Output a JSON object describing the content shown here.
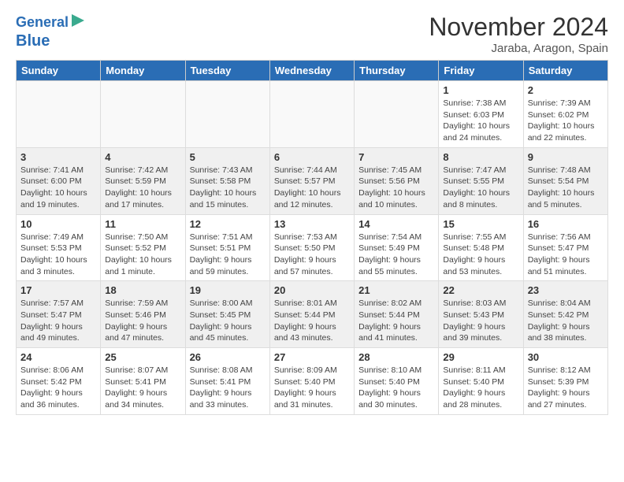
{
  "header": {
    "logo_line1": "General",
    "logo_line2": "Blue",
    "month": "November 2024",
    "location": "Jaraba, Aragon, Spain"
  },
  "weekdays": [
    "Sunday",
    "Monday",
    "Tuesday",
    "Wednesday",
    "Thursday",
    "Friday",
    "Saturday"
  ],
  "weeks": [
    {
      "bg": "white",
      "days": [
        {
          "num": "",
          "info": ""
        },
        {
          "num": "",
          "info": ""
        },
        {
          "num": "",
          "info": ""
        },
        {
          "num": "",
          "info": ""
        },
        {
          "num": "",
          "info": ""
        },
        {
          "num": "1",
          "info": "Sunrise: 7:38 AM\nSunset: 6:03 PM\nDaylight: 10 hours and 24 minutes."
        },
        {
          "num": "2",
          "info": "Sunrise: 7:39 AM\nSunset: 6:02 PM\nDaylight: 10 hours and 22 minutes."
        }
      ]
    },
    {
      "bg": "gray",
      "days": [
        {
          "num": "3",
          "info": "Sunrise: 7:41 AM\nSunset: 6:00 PM\nDaylight: 10 hours and 19 minutes."
        },
        {
          "num": "4",
          "info": "Sunrise: 7:42 AM\nSunset: 5:59 PM\nDaylight: 10 hours and 17 minutes."
        },
        {
          "num": "5",
          "info": "Sunrise: 7:43 AM\nSunset: 5:58 PM\nDaylight: 10 hours and 15 minutes."
        },
        {
          "num": "6",
          "info": "Sunrise: 7:44 AM\nSunset: 5:57 PM\nDaylight: 10 hours and 12 minutes."
        },
        {
          "num": "7",
          "info": "Sunrise: 7:45 AM\nSunset: 5:56 PM\nDaylight: 10 hours and 10 minutes."
        },
        {
          "num": "8",
          "info": "Sunrise: 7:47 AM\nSunset: 5:55 PM\nDaylight: 10 hours and 8 minutes."
        },
        {
          "num": "9",
          "info": "Sunrise: 7:48 AM\nSunset: 5:54 PM\nDaylight: 10 hours and 5 minutes."
        }
      ]
    },
    {
      "bg": "white",
      "days": [
        {
          "num": "10",
          "info": "Sunrise: 7:49 AM\nSunset: 5:53 PM\nDaylight: 10 hours and 3 minutes."
        },
        {
          "num": "11",
          "info": "Sunrise: 7:50 AM\nSunset: 5:52 PM\nDaylight: 10 hours and 1 minute."
        },
        {
          "num": "12",
          "info": "Sunrise: 7:51 AM\nSunset: 5:51 PM\nDaylight: 9 hours and 59 minutes."
        },
        {
          "num": "13",
          "info": "Sunrise: 7:53 AM\nSunset: 5:50 PM\nDaylight: 9 hours and 57 minutes."
        },
        {
          "num": "14",
          "info": "Sunrise: 7:54 AM\nSunset: 5:49 PM\nDaylight: 9 hours and 55 minutes."
        },
        {
          "num": "15",
          "info": "Sunrise: 7:55 AM\nSunset: 5:48 PM\nDaylight: 9 hours and 53 minutes."
        },
        {
          "num": "16",
          "info": "Sunrise: 7:56 AM\nSunset: 5:47 PM\nDaylight: 9 hours and 51 minutes."
        }
      ]
    },
    {
      "bg": "gray",
      "days": [
        {
          "num": "17",
          "info": "Sunrise: 7:57 AM\nSunset: 5:47 PM\nDaylight: 9 hours and 49 minutes."
        },
        {
          "num": "18",
          "info": "Sunrise: 7:59 AM\nSunset: 5:46 PM\nDaylight: 9 hours and 47 minutes."
        },
        {
          "num": "19",
          "info": "Sunrise: 8:00 AM\nSunset: 5:45 PM\nDaylight: 9 hours and 45 minutes."
        },
        {
          "num": "20",
          "info": "Sunrise: 8:01 AM\nSunset: 5:44 PM\nDaylight: 9 hours and 43 minutes."
        },
        {
          "num": "21",
          "info": "Sunrise: 8:02 AM\nSunset: 5:44 PM\nDaylight: 9 hours and 41 minutes."
        },
        {
          "num": "22",
          "info": "Sunrise: 8:03 AM\nSunset: 5:43 PM\nDaylight: 9 hours and 39 minutes."
        },
        {
          "num": "23",
          "info": "Sunrise: 8:04 AM\nSunset: 5:42 PM\nDaylight: 9 hours and 38 minutes."
        }
      ]
    },
    {
      "bg": "white",
      "days": [
        {
          "num": "24",
          "info": "Sunrise: 8:06 AM\nSunset: 5:42 PM\nDaylight: 9 hours and 36 minutes."
        },
        {
          "num": "25",
          "info": "Sunrise: 8:07 AM\nSunset: 5:41 PM\nDaylight: 9 hours and 34 minutes."
        },
        {
          "num": "26",
          "info": "Sunrise: 8:08 AM\nSunset: 5:41 PM\nDaylight: 9 hours and 33 minutes."
        },
        {
          "num": "27",
          "info": "Sunrise: 8:09 AM\nSunset: 5:40 PM\nDaylight: 9 hours and 31 minutes."
        },
        {
          "num": "28",
          "info": "Sunrise: 8:10 AM\nSunset: 5:40 PM\nDaylight: 9 hours and 30 minutes."
        },
        {
          "num": "29",
          "info": "Sunrise: 8:11 AM\nSunset: 5:40 PM\nDaylight: 9 hours and 28 minutes."
        },
        {
          "num": "30",
          "info": "Sunrise: 8:12 AM\nSunset: 5:39 PM\nDaylight: 9 hours and 27 minutes."
        }
      ]
    }
  ]
}
